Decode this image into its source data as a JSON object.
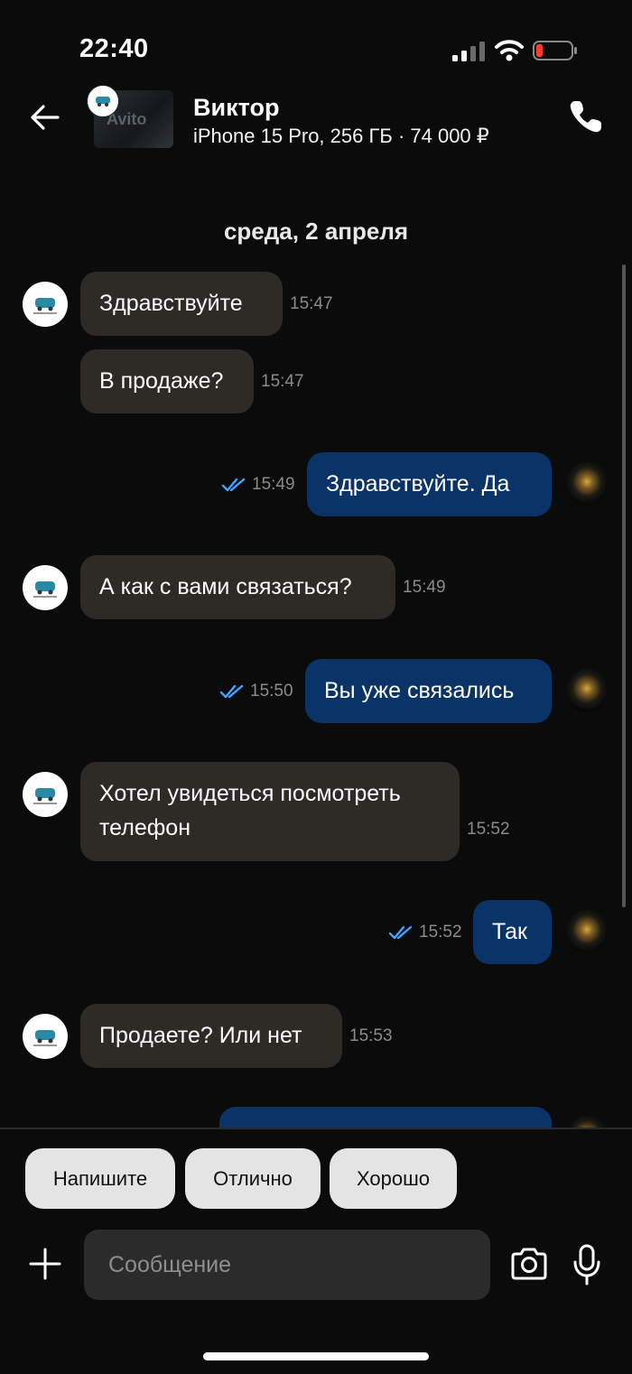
{
  "status_bar": {
    "time": "22:40"
  },
  "header": {
    "contact_name": "Виктор",
    "listing": "iPhone 15 Pro, 256 ГБ · 74 000 ₽",
    "thumb_watermark": "Avito"
  },
  "chat": {
    "date": "среда, 2 апреля",
    "messages": [
      {
        "dir": "in",
        "text": "Здравствуйте",
        "time": "15:47"
      },
      {
        "dir": "in",
        "text": "В продаже?",
        "time": "15:47"
      },
      {
        "dir": "out",
        "text": "Здравствуйте. Да",
        "time": "15:49"
      },
      {
        "dir": "in",
        "text": "А как с вами связаться?",
        "time": "15:49"
      },
      {
        "dir": "out",
        "text": "Вы уже связались",
        "time": "15:50"
      },
      {
        "dir": "in",
        "text_line1": "Хотел увидеться посмотреть",
        "text_line2": "телефон",
        "time": "15:52"
      },
      {
        "dir": "out",
        "text": "Так",
        "time": "15:52"
      },
      {
        "dir": "in",
        "text": "Продаете? Или нет",
        "time": "15:53"
      }
    ]
  },
  "quick_replies": [
    "Напишите",
    "Отлично",
    "Хорошо"
  ],
  "composer": {
    "placeholder": "Сообщение"
  },
  "colors": {
    "background": "#0b0b0b",
    "incoming_bubble": "#2e2a25",
    "outgoing_bubble": "#0a3468",
    "read_ticks": "#3fa3ff"
  }
}
